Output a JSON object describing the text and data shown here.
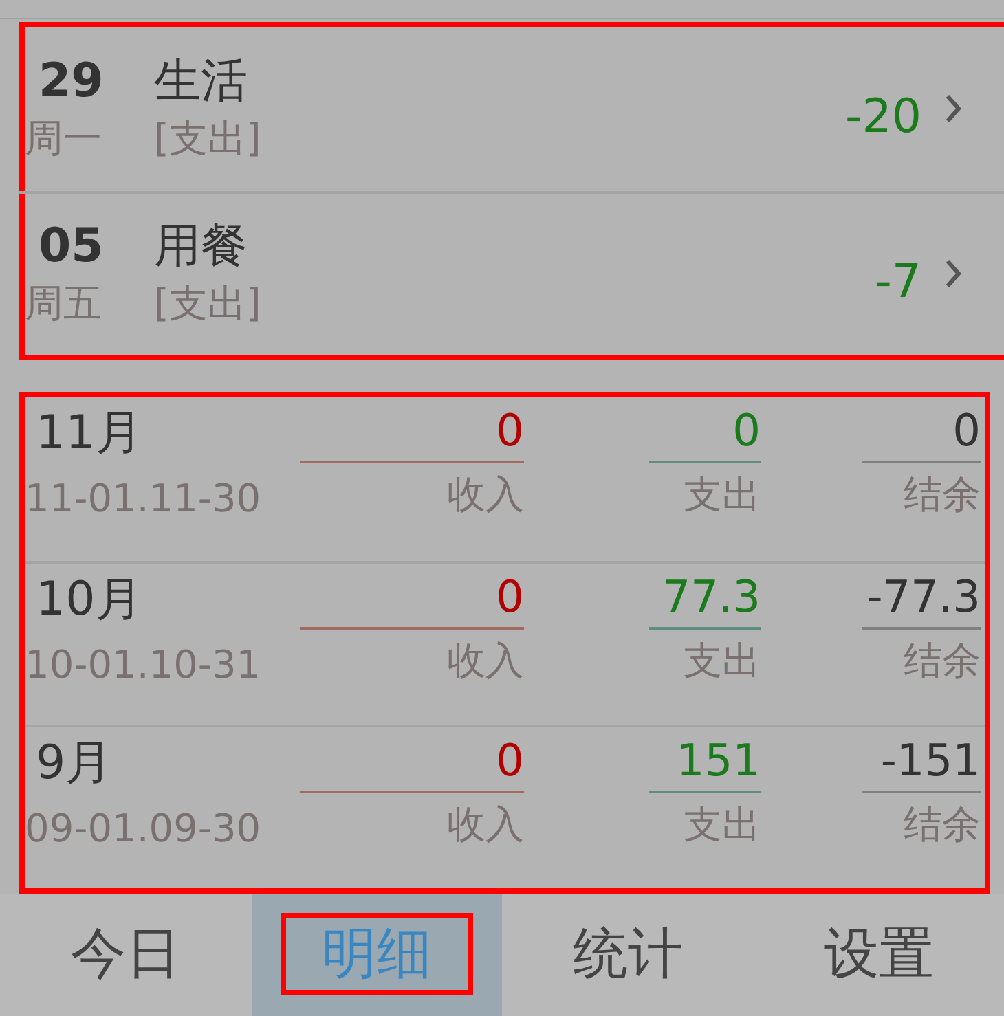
{
  "entries_highlighted": true,
  "entries": [
    {
      "day": "29",
      "weekday": "周一",
      "category": "生活",
      "type": "[支出]",
      "amount": "-20"
    },
    {
      "day": "05",
      "weekday": "周五",
      "category": "用餐",
      "type": "[支出]",
      "amount": "-7"
    }
  ],
  "months_highlighted": true,
  "months": [
    {
      "month": "11月",
      "range": "11-01.11-30",
      "income": "0",
      "income_label": "收入",
      "expense": "0",
      "expense_label": "支出",
      "balance": "0",
      "balance_label": "结余"
    },
    {
      "month": "10月",
      "range": "10-01.10-31",
      "income": "0",
      "income_label": "收入",
      "expense": "77.3",
      "expense_label": "支出",
      "balance": "-77.3",
      "balance_label": "结余"
    },
    {
      "month": "9月",
      "range": "09-01.09-30",
      "income": "0",
      "income_label": "收入",
      "expense": "151",
      "expense_label": "支出",
      "balance": "-151",
      "balance_label": "结余"
    }
  ],
  "tabs": [
    {
      "label": "今日",
      "selected": false,
      "highlighted": false
    },
    {
      "label": "明细",
      "selected": true,
      "highlighted": true
    },
    {
      "label": "统计",
      "selected": false,
      "highlighted": false
    },
    {
      "label": "设置",
      "selected": false,
      "highlighted": false
    }
  ]
}
